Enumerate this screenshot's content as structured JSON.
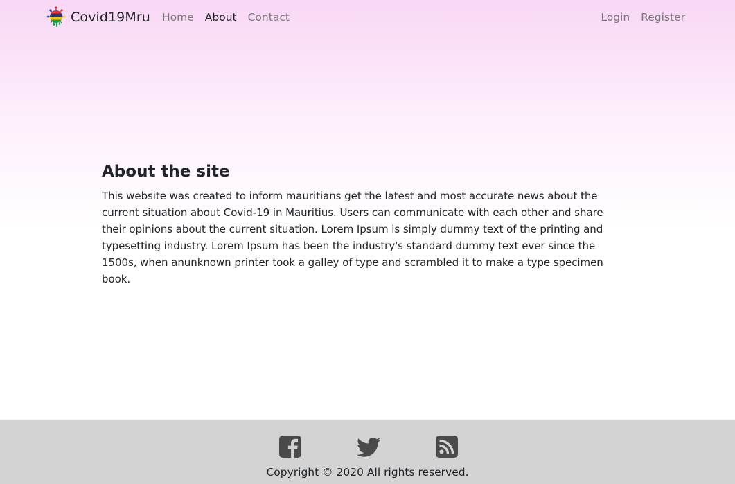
{
  "navbar": {
    "brand": "Covid19Mru",
    "brand_logo_icon": "mauritius-virus-logo-icon",
    "links_left": [
      {
        "label": "Home",
        "active": false
      },
      {
        "label": "About",
        "active": true
      },
      {
        "label": "Contact",
        "active": false
      }
    ],
    "links_right": [
      {
        "label": "Login"
      },
      {
        "label": "Register"
      }
    ]
  },
  "main": {
    "heading": "About the site",
    "paragraph": "This website was created to inform mauritians get the latest and most accurate news about the current situation about Covid-19 in Mauritius. Users can communicate with each other and share their opinions about the current situation. Lorem Ipsum is simply dummy text of the printing and typesetting industry. Lorem Ipsum has been the industry's standard dummy text ever since the 1500s, when anunknown printer took a galley of type and scrambled it to make a type specimen book."
  },
  "footer": {
    "social_icons": [
      "facebook-icon",
      "twitter-icon",
      "rss-icon"
    ],
    "copyright": "Copyright © 2020 All rights reserved."
  },
  "colors": {
    "header_gradient_top": "#f8d7f5",
    "footer_background": "#d3d3d3",
    "icon_color": "#4a4a4a",
    "nav_link_color": "#7a7a7a",
    "nav_active_color": "#212529"
  }
}
